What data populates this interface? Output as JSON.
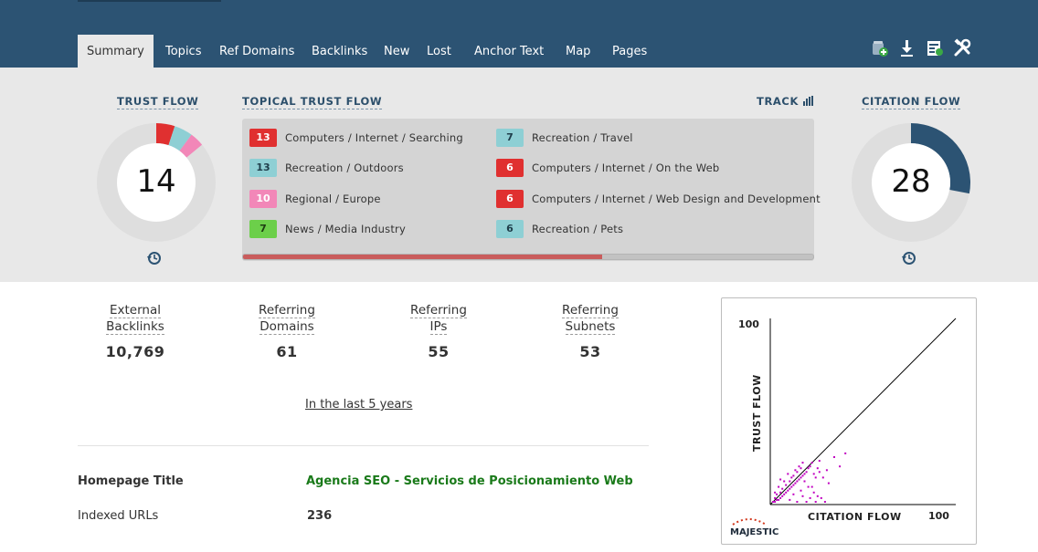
{
  "nav": {
    "tabs": [
      {
        "label": "Summary",
        "active": true
      },
      {
        "label": "Topics"
      },
      {
        "label": "Ref Domains"
      },
      {
        "label": "Backlinks"
      },
      {
        "label": "New"
      },
      {
        "label": "Lost"
      },
      {
        "label": "Anchor Text"
      },
      {
        "label": "Map"
      },
      {
        "label": "Pages"
      }
    ],
    "icons": [
      "add-to-bucket-icon",
      "download-icon",
      "report-icon",
      "tools-icon"
    ]
  },
  "trust_flow": {
    "label": "TRUST FLOW",
    "value": 14,
    "segments": [
      {
        "value": 13,
        "color": "#e03030"
      },
      {
        "value": 13,
        "color": "#8ecfd4"
      },
      {
        "value": 10,
        "color": "#f287b8"
      }
    ]
  },
  "citation_flow": {
    "label": "CITATION FLOW",
    "value": 28,
    "color": "#2c5373"
  },
  "topical_trust_flow": {
    "label": "TOPICAL TRUST FLOW",
    "track_label": "TRACK",
    "progress": 0.63,
    "items": [
      {
        "value": "13",
        "label": "Computers / Internet / Searching",
        "color": "#e03030",
        "text_color": "#ffffff"
      },
      {
        "value": "13",
        "label": "Recreation / Outdoors",
        "color": "#8ecfd4",
        "text_color": "#1f3d4a"
      },
      {
        "value": "10",
        "label": "Regional / Europe",
        "color": "#f287b8",
        "text_color": "#ffffff"
      },
      {
        "value": "7",
        "label": "News / Media Industry",
        "color": "#6ccf4a",
        "text_color": "#1e3d12"
      },
      {
        "value": "7",
        "label": "Recreation / Travel",
        "color": "#8ecfd4",
        "text_color": "#1f3d4a"
      },
      {
        "value": "6",
        "label": "Computers / Internet / On the Web",
        "color": "#e03030",
        "text_color": "#ffffff"
      },
      {
        "value": "6",
        "label": "Computers / Internet / Web Design and Development",
        "color": "#e03030",
        "text_color": "#ffffff"
      },
      {
        "value": "6",
        "label": "Recreation / Pets",
        "color": "#8ecfd4",
        "text_color": "#1f3d4a"
      }
    ]
  },
  "stats": [
    {
      "label_1": "External",
      "label_2": "Backlinks",
      "value": "10,769"
    },
    {
      "label_1": "Referring",
      "label_2": "Domains",
      "value": "61"
    },
    {
      "label_1": "Referring",
      "label_2": "IPs",
      "value": "55"
    },
    {
      "label_1": "Referring",
      "label_2": "Subnets",
      "value": "53"
    }
  ],
  "period_link": "In the last 5 years",
  "homepage": {
    "title_label": "Homepage Title",
    "title_value": "Agencia SEO - Servicios de Posicionamiento Web",
    "indexed_label": "Indexed URLs",
    "indexed_value": "236"
  },
  "chart_data": {
    "type": "scatter",
    "xlabel": "CITATION FLOW",
    "ylabel": "TRUST FLOW",
    "xlim": [
      0,
      100
    ],
    "ylim": [
      0,
      100
    ],
    "x_max_label": "100",
    "y_max_label": "100",
    "diagonal": true,
    "point_color": "#c000c0",
    "logo_text": "MAJESTIC",
    "points": [
      [
        1,
        1
      ],
      [
        2,
        1
      ],
      [
        3,
        2
      ],
      [
        4,
        2
      ],
      [
        2,
        3
      ],
      [
        5,
        3
      ],
      [
        6,
        4
      ],
      [
        3,
        5
      ],
      [
        7,
        5
      ],
      [
        8,
        6
      ],
      [
        5,
        6
      ],
      [
        9,
        7
      ],
      [
        10,
        8
      ],
      [
        6,
        8
      ],
      [
        11,
        9
      ],
      [
        12,
        10
      ],
      [
        8,
        10
      ],
      [
        13,
        11
      ],
      [
        14,
        12
      ],
      [
        10,
        12
      ],
      [
        15,
        13
      ],
      [
        16,
        14
      ],
      [
        12,
        15
      ],
      [
        17,
        15
      ],
      [
        18,
        16
      ],
      [
        14,
        17
      ],
      [
        19,
        17
      ],
      [
        20,
        19
      ],
      [
        16,
        19
      ],
      [
        21,
        20
      ],
      [
        17,
        22
      ],
      [
        22,
        22
      ],
      [
        18,
        12
      ],
      [
        20,
        9
      ],
      [
        23,
        6
      ],
      [
        25,
        4
      ],
      [
        27,
        3
      ],
      [
        29,
        1
      ],
      [
        4,
        9
      ],
      [
        7,
        12
      ],
      [
        11,
        14
      ],
      [
        9,
        16
      ],
      [
        13,
        18
      ],
      [
        15,
        20
      ],
      [
        24,
        14
      ],
      [
        26,
        17
      ],
      [
        24,
        1
      ],
      [
        19,
        1
      ],
      [
        14,
        1
      ],
      [
        10,
        2
      ],
      [
        21,
        3
      ],
      [
        17,
        4
      ],
      [
        12,
        5
      ],
      [
        28,
        14
      ],
      [
        25,
        19
      ],
      [
        30,
        18
      ],
      [
        34,
        25
      ],
      [
        37,
        20
      ],
      [
        40,
        27
      ],
      [
        31,
        11
      ],
      [
        26,
        23
      ],
      [
        23,
        16
      ],
      [
        5,
        13
      ],
      [
        2,
        6
      ],
      [
        16,
        7
      ],
      [
        22,
        9
      ]
    ]
  }
}
